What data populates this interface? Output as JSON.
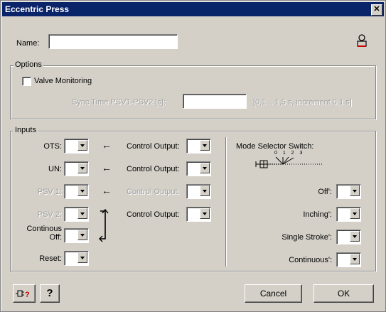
{
  "window": {
    "title": "Eccentric Press",
    "close": "✕"
  },
  "name": {
    "label": "Name:",
    "value": ""
  },
  "options": {
    "title": "Options",
    "valve_monitoring": "Valve Monitoring",
    "sync_label": "Sync Time PSV1-PSV2 [s]:",
    "sync_value": "",
    "sync_hint": "[0,1 .. 1,5 s, increment 0,1 s]"
  },
  "inputs": {
    "title": "Inputs",
    "rows": [
      {
        "label": "OTS:",
        "ctrl": "Control Output:"
      },
      {
        "label": "UN:",
        "ctrl": "Control Output:"
      },
      {
        "label": "PSV 1:",
        "ctrl": "Control Output:"
      },
      {
        "label": "PSV 2:",
        "ctrl": "Control Output:"
      }
    ],
    "continous_off": "Continous\nOff:",
    "reset": "Reset:",
    "mode_title": "Mode Selector Switch:",
    "mode_numbers": "0 1 2 3",
    "modes": [
      "Off':",
      "Inching':",
      "Single Stroke':",
      "Continuous':"
    ]
  },
  "buttons": {
    "cancel": "Cancel",
    "ok": "OK",
    "help": "?"
  }
}
